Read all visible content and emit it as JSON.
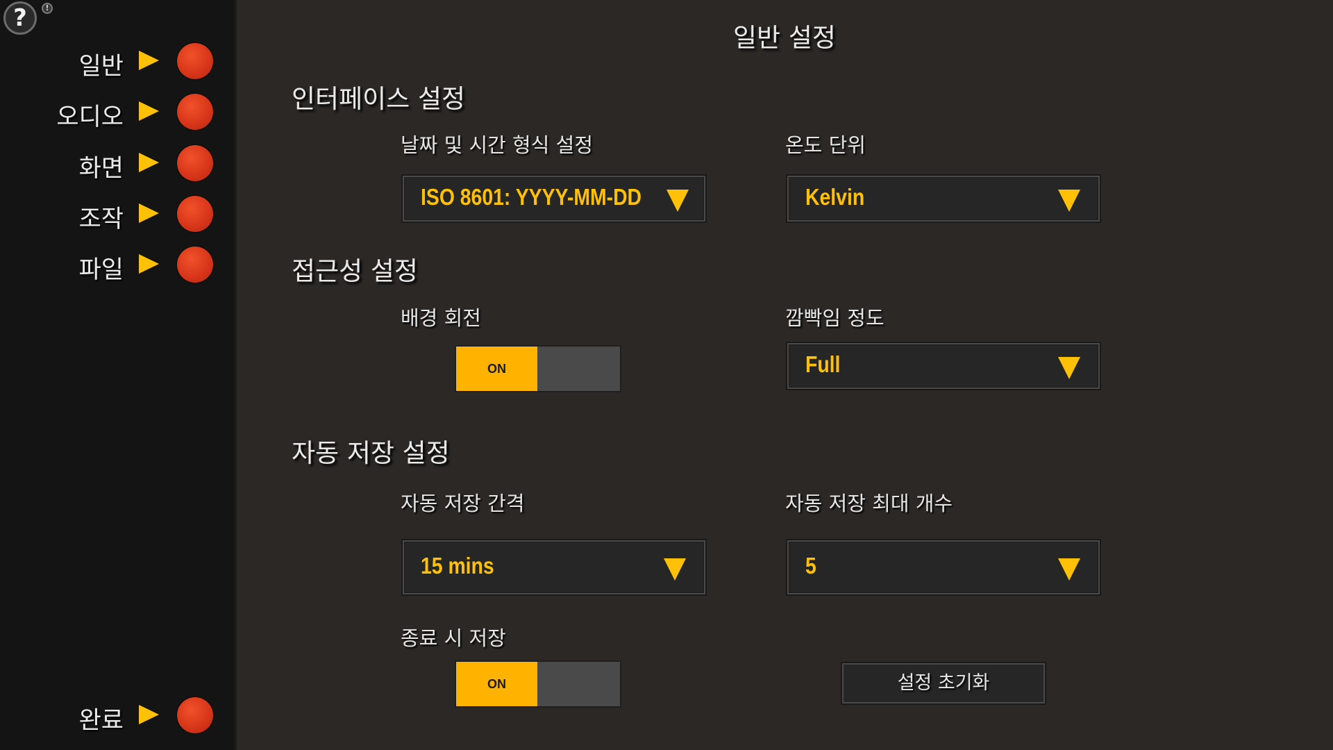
{
  "sidebar": {
    "help_glyph": "?",
    "alert_glyph": "!",
    "items": [
      {
        "label": "일반"
      },
      {
        "label": "오디오"
      },
      {
        "label": "화면"
      },
      {
        "label": "조작"
      },
      {
        "label": "파일"
      }
    ],
    "done": {
      "label": "완료"
    }
  },
  "main": {
    "title": "일반 설정",
    "interface": {
      "heading": "인터페이스 설정",
      "date_format": {
        "label": "날짜 및 시간 형식 설정",
        "value": "ISO 8601: YYYY-MM-DD"
      },
      "temp_unit": {
        "label": "온도 단위",
        "value": "Kelvin"
      }
    },
    "accessibility": {
      "heading": "접근성 설정",
      "bg_rotation": {
        "label": "배경 회전",
        "state": "ON"
      },
      "blink_level": {
        "label": "깜빡임 정도",
        "value": "Full"
      }
    },
    "autosave": {
      "heading": "자동 저장 설정",
      "interval": {
        "label": "자동 저장 간격",
        "value": "15 mins"
      },
      "max_count": {
        "label": "자동 저장 최대 개수",
        "value": "5"
      },
      "save_on_exit": {
        "label": "종료 시 저장",
        "state": "ON"
      }
    },
    "reset_label": "설정 초기화"
  },
  "colors": {
    "accent": "#ffc107",
    "toggle_on": "#ffb300",
    "dot": "#d9361a",
    "panel": "#2b2826",
    "sidebar": "#141414"
  }
}
